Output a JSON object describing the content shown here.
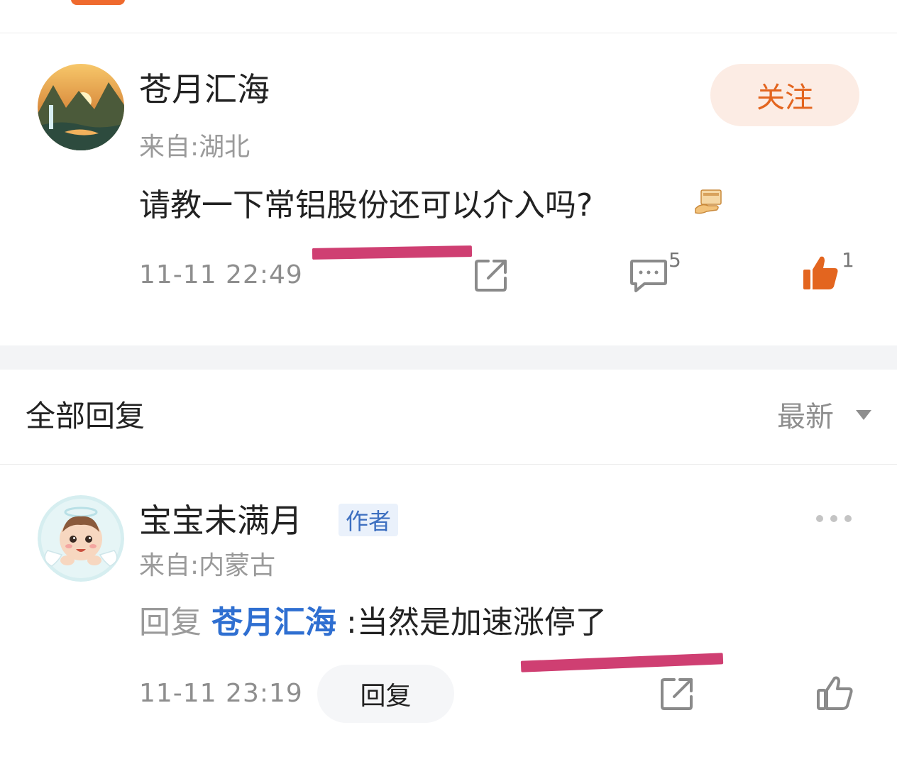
{
  "post": {
    "user_name": "苍月汇海",
    "location": "来自:湖北",
    "follow_label": "关注",
    "content": "请教一下常铝股份还可以介入吗?",
    "time": "11-11 22:49",
    "comment_count": "5",
    "like_count": "1",
    "icons": [
      "money-emoji-icon",
      "share-icon",
      "comment-icon",
      "like-filled-icon"
    ]
  },
  "replies_section": {
    "title": "全部回复",
    "sort_label": "最新"
  },
  "reply": {
    "user_name": "宝宝未满月",
    "badge": "作者",
    "location": "来自:内蒙古",
    "reply_prefix": "回复",
    "reply_target": "苍月汇海",
    "colon": ":",
    "content": "当然是加速涨停了",
    "time": "11-11 23:19",
    "reply_button_label": "回复",
    "icons": [
      "more-icon",
      "share-icon",
      "like-outline-icon"
    ]
  },
  "colors": {
    "accent": "#e3651f",
    "accent_bg": "#fcece4",
    "link_blue": "#2f6fd1",
    "annotation_mark": "#cf3f72"
  }
}
